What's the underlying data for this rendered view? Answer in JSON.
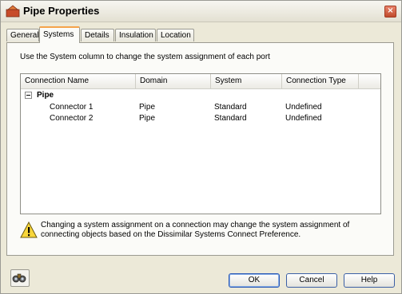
{
  "window": {
    "title": "Pipe Properties",
    "close_glyph": "×"
  },
  "tabs": [
    {
      "label": "General",
      "active": false
    },
    {
      "label": "Systems",
      "active": true
    },
    {
      "label": "Details",
      "active": false
    },
    {
      "label": "Insulation",
      "active": false
    },
    {
      "label": "Location",
      "active": false
    }
  ],
  "instruction": "Use the System column to change the system assignment of each port",
  "table": {
    "columns": [
      "Connection Name",
      "Domain",
      "System",
      "Connection Type"
    ],
    "group": {
      "label": "Pipe",
      "expanded": true
    },
    "rows": [
      [
        "Connector 1",
        "Pipe",
        "Standard",
        "Undefined"
      ],
      [
        "Connector 2",
        "Pipe",
        "Standard",
        "Undefined"
      ]
    ]
  },
  "warning": {
    "icon": "warning-icon",
    "line1": "Changing a system assignment on a connection may change the system assignment of",
    "line2": "connecting objects based on the Dissimilar Systems Connect Preference."
  },
  "buttons": {
    "ok": "OK",
    "cancel": "Cancel",
    "help": "Help"
  },
  "colors": {
    "dialog_bg": "#ece9d8",
    "active_tab_accent": "#f5a34b",
    "button_border": "#3b5fa5"
  }
}
